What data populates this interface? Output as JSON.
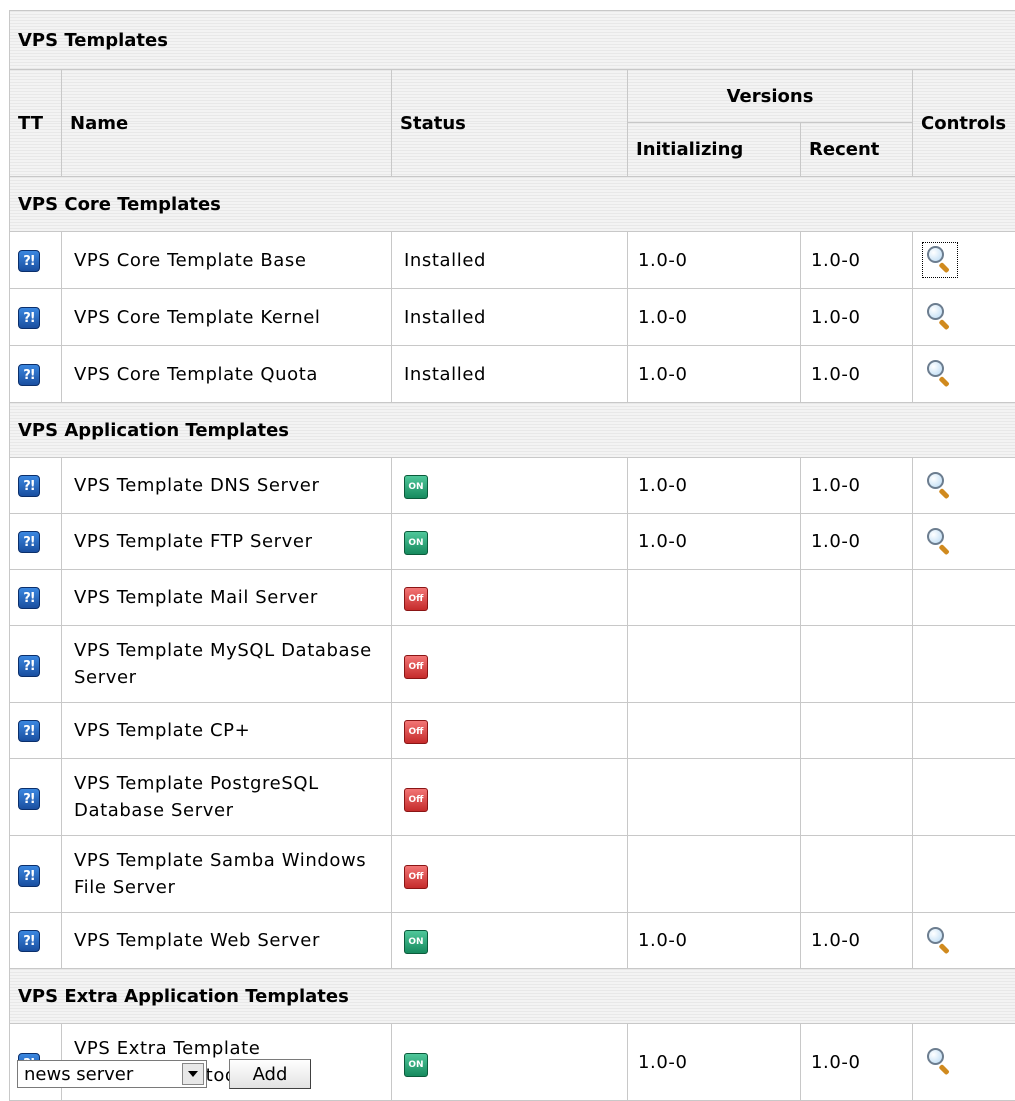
{
  "panel_title": "VPS Templates",
  "columns": {
    "tt": "TT",
    "name": "Name",
    "status": "Status",
    "versions": "Versions",
    "initializing": "Initializing",
    "recent": "Recent",
    "controls": "Controls"
  },
  "icons": {
    "help": "help-question-icon",
    "status_on": "ON",
    "status_off": "Off",
    "view": "magnifier-icon"
  },
  "colors": {
    "on": "#1f9c6b",
    "off": "#d63a3a",
    "help": "#2a6fd1"
  },
  "sections": [
    {
      "title": "VPS Core Templates",
      "rows": [
        {
          "name": "VPS Core Template Base",
          "status_text": "Installed",
          "initializing": "1.0-0",
          "recent": "1.0-0",
          "control": true,
          "focused": true
        },
        {
          "name": "VPS Core Template Kernel",
          "status_text": "Installed",
          "initializing": "1.0-0",
          "recent": "1.0-0",
          "control": true
        },
        {
          "name": "VPS Core Template Quota",
          "status_text": "Installed",
          "initializing": "1.0-0",
          "recent": "1.0-0",
          "control": true
        }
      ]
    },
    {
      "title": "VPS Application Templates",
      "rows": [
        {
          "name": "VPS Template DNS Server",
          "status": "on",
          "initializing": "1.0-0",
          "recent": "1.0-0",
          "control": true
        },
        {
          "name": "VPS Template FTP Server",
          "status": "on",
          "initializing": "1.0-0",
          "recent": "1.0-0",
          "control": true
        },
        {
          "name": "VPS Template Mail Server",
          "status": "off"
        },
        {
          "name": "VPS Template MySQL Database Server",
          "status": "off",
          "wrap": true
        },
        {
          "name": "VPS Template CP+",
          "status": "off"
        },
        {
          "name": "VPS Template PostgreSQL Database Server",
          "status": "off",
          "wrap": true
        },
        {
          "name": "VPS Template Samba Windows File Server",
          "status": "off",
          "wrap": true
        },
        {
          "name": "VPS Template Web Server",
          "status": "on",
          "initializing": "1.0-0",
          "recent": "1.0-0",
          "control": true
        }
      ]
    },
    {
      "title": "VPS Extra Application Templates",
      "rows": [
        {
          "name": "VPS Extra Template development tools",
          "status": "on",
          "initializing": "1.0-0",
          "recent": "1.0-0",
          "control": true,
          "wrap": true
        }
      ]
    }
  ],
  "add_form": {
    "selected": "news server",
    "button_label": "Add"
  }
}
